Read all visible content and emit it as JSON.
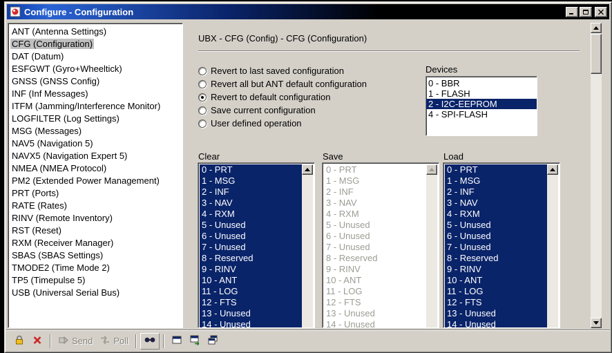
{
  "window": {
    "title": "Configure - Configuration",
    "app_icon": "u-center-app-icon",
    "caption_buttons": [
      "minimize",
      "maximize",
      "close"
    ]
  },
  "sidebar": {
    "items": [
      {
        "label": "ANT (Antenna Settings)",
        "selected": false
      },
      {
        "label": "CFG (Configuration)",
        "selected": true
      },
      {
        "label": "DAT (Datum)",
        "selected": false
      },
      {
        "label": "ESFGWT (Gyro+Wheeltick)",
        "selected": false
      },
      {
        "label": "GNSS (GNSS Config)",
        "selected": false
      },
      {
        "label": "INF (Inf Messages)",
        "selected": false
      },
      {
        "label": "ITFM (Jamming/Interference Monitor)",
        "selected": false
      },
      {
        "label": "LOGFILTER (Log Settings)",
        "selected": false
      },
      {
        "label": "MSG (Messages)",
        "selected": false
      },
      {
        "label": "NAV5 (Navigation 5)",
        "selected": false
      },
      {
        "label": "NAVX5 (Navigation Expert 5)",
        "selected": false
      },
      {
        "label": "NMEA (NMEA Protocol)",
        "selected": false
      },
      {
        "label": "PM2 (Extended Power Management)",
        "selected": false
      },
      {
        "label": "PRT (Ports)",
        "selected": false
      },
      {
        "label": "RATE (Rates)",
        "selected": false
      },
      {
        "label": "RINV (Remote Inventory)",
        "selected": false
      },
      {
        "label": "RST (Reset)",
        "selected": false
      },
      {
        "label": "RXM (Receiver Manager)",
        "selected": false
      },
      {
        "label": "SBAS (SBAS Settings)",
        "selected": false
      },
      {
        "label": "TMODE2 (Time Mode 2)",
        "selected": false
      },
      {
        "label": "TP5 (Timepulse 5)",
        "selected": false
      },
      {
        "label": "USB (Universal Serial Bus)",
        "selected": false
      }
    ]
  },
  "main": {
    "heading": "UBX - CFG (Config) - CFG (Configuration)",
    "radios": [
      {
        "label": "Revert to last saved configuration",
        "selected": false
      },
      {
        "label": "Revert all but ANT default configuration",
        "selected": false
      },
      {
        "label": "Revert to default configuration",
        "selected": true
      },
      {
        "label": "Save current configuration",
        "selected": false
      },
      {
        "label": "User defined operation",
        "selected": false
      }
    ],
    "devices": {
      "label": "Devices",
      "items": [
        {
          "label": "0 - BBR",
          "selected": false
        },
        {
          "label": "1 - FLASH",
          "selected": false
        },
        {
          "label": "2 - I2C-EEPROM",
          "selected": true
        },
        {
          "label": "4 - SPI-FLASH",
          "selected": false
        }
      ]
    },
    "lists": [
      {
        "label": "Clear",
        "state": "selected",
        "items": [
          "0 - PRT",
          "1 - MSG",
          "2 - INF",
          "3 - NAV",
          "4 - RXM",
          "5 - Unused",
          "6 - Unused",
          "7 - Unused",
          "8 - Reserved",
          "9 - RINV",
          "10 - ANT",
          "11 - LOG",
          "12 - FTS",
          "13 - Unused",
          "14 - Unused"
        ]
      },
      {
        "label": "Save",
        "state": "disabled",
        "items": [
          "0 - PRT",
          "1 - MSG",
          "2 - INF",
          "3 - NAV",
          "4 - RXM",
          "5 - Unused",
          "6 - Unused",
          "7 - Unused",
          "8 - Reserved",
          "9 - RINV",
          "10 - ANT",
          "11 - LOG",
          "12 - FTS",
          "13 - Unused",
          "14 - Unused"
        ]
      },
      {
        "label": "Load",
        "state": "selected",
        "items": [
          "0 - PRT",
          "1 - MSG",
          "2 - INF",
          "3 - NAV",
          "4 - RXM",
          "5 - Unused",
          "6 - Unused",
          "7 - Unused",
          "8 - Reserved",
          "9 - RINV",
          "10 - ANT",
          "11 - LOG",
          "12 - FTS",
          "13 - Unused",
          "14 - Unused"
        ]
      }
    ]
  },
  "toolbar": {
    "buttons": [
      {
        "name": "lock",
        "icon": "padlock-icon",
        "enabled": true
      },
      {
        "name": "delete",
        "icon": "red-x-icon",
        "enabled": true
      },
      {
        "name": "send",
        "label": "Send",
        "icon": "send-icon",
        "enabled": false
      },
      {
        "name": "poll",
        "label": "Poll",
        "icon": "poll-icon",
        "enabled": false
      },
      {
        "name": "poll-current",
        "icon": "binoculars-icon",
        "enabled": true
      },
      {
        "name": "table-view",
        "icon": "table-window-icon",
        "enabled": true
      },
      {
        "name": "message-view",
        "icon": "table-arrow-icon",
        "enabled": true
      },
      {
        "name": "stacked-windows",
        "icon": "windows-icon",
        "enabled": true
      }
    ]
  },
  "colors": {
    "selection_bg": "#0a246a",
    "selection_text": "#ffffff",
    "window_bg": "#d4d0c8",
    "disabled_text": "#9c9c94",
    "titlebar_blue": "#2a63d4",
    "titlebar_dark": "#000000",
    "sidebar_selected_bg": "#c0c0c0"
  }
}
